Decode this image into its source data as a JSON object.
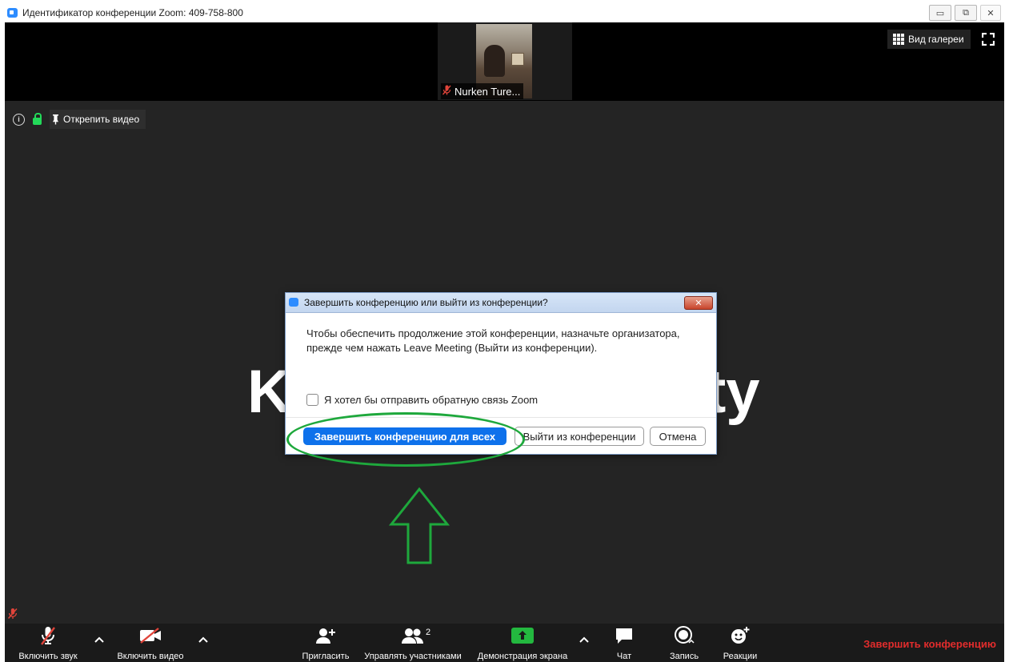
{
  "window": {
    "title": "Идентификатор конференции Zoom: 409-758-800",
    "buttons": {
      "minimize": "▭",
      "restore": "⧉",
      "close": "✕"
    }
  },
  "top_strip": {
    "participant_name": "Nurken Ture...",
    "gallery_view_label": "Вид галереи"
  },
  "info_bar": {
    "unpin_label": "Открепить видео"
  },
  "shared_content": {
    "text_left": "K",
    "text_right": "ty"
  },
  "dialog": {
    "title": "Завершить конференцию или выйти из конференции?",
    "close_label": "✕",
    "message": "Чтобы обеспечить продолжение этой конференции, назначьте организатора, прежде чем нажать Leave Meeting (Выйти из конференции).",
    "checkbox_label": "Я хотел бы отправить обратную связь Zoom",
    "checkbox_checked": false,
    "primary_button": "Завершить конференцию для всех",
    "leave_button": "Выйти из конференции",
    "cancel_button": "Отмена"
  },
  "annotation": {
    "color": "#1ea83c",
    "shapes": [
      "ellipse",
      "up-arrow"
    ]
  },
  "toolbar": {
    "unmute_label": "Включить звук",
    "video_label": "Включить видео",
    "invite_label": "Пригласить",
    "participants_label": "Управлять участниками",
    "participants_count": "2",
    "share_label": "Демонстрация экрана",
    "chat_label": "Чат",
    "record_label": "Запись",
    "reactions_label": "Реакции",
    "end_label": "Завершить конференцию",
    "caret": "^"
  },
  "colors": {
    "meeting_bg": "#242424",
    "primary_blue": "#0e71eb",
    "share_green": "#23b83f",
    "end_red": "#e22c2c",
    "mute_red": "#e0443a"
  }
}
